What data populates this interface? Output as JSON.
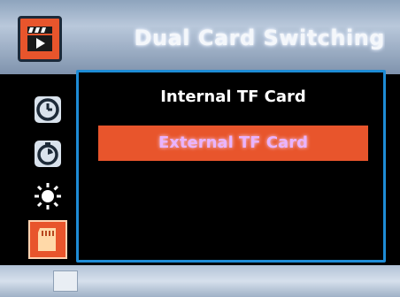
{
  "header": {
    "title": "Dual Card Switching",
    "icon": "video-mode-icon"
  },
  "sidebar": {
    "items": [
      {
        "icon": "clock-icon"
      },
      {
        "icon": "timer-icon"
      },
      {
        "icon": "brightness-icon"
      },
      {
        "icon": "sd-card-icon",
        "selected": true
      }
    ]
  },
  "menu": {
    "options": [
      {
        "label": "Internal TF Card",
        "selected": false
      },
      {
        "label": "External TF Card",
        "selected": true
      }
    ]
  },
  "colors": {
    "accent": "#e8552c",
    "panel_border": "#1e8cd6",
    "selected_text": "#e9b3ff"
  }
}
